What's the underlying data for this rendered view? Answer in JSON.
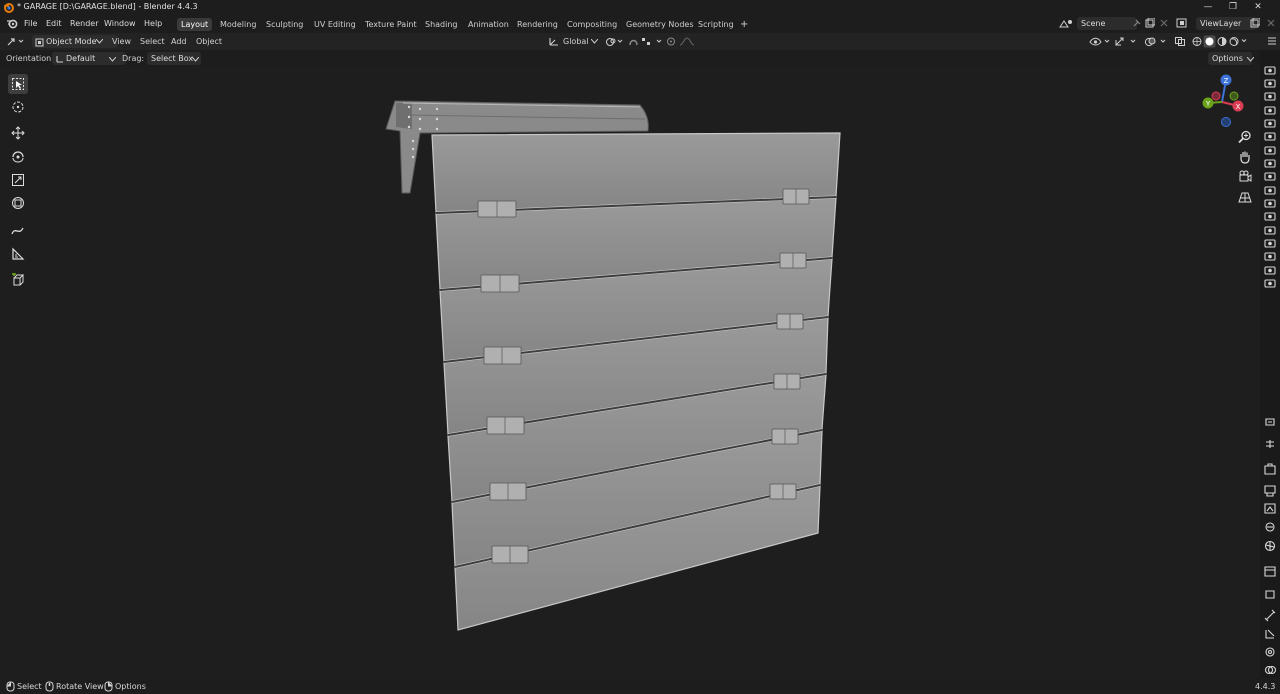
{
  "window": {
    "title": "* GARAGE [D:\\GARAGE.blend] - Blender 4.4.3",
    "minimize": "—",
    "restore": "❐",
    "close": "✕"
  },
  "menu": [
    "File",
    "Edit",
    "Render",
    "Window",
    "Help"
  ],
  "workspaces": [
    "Layout",
    "Modeling",
    "Sculpting",
    "UV Editing",
    "Texture Paint",
    "Shading",
    "Animation",
    "Rendering",
    "Compositing",
    "Geometry Nodes",
    "Scripting"
  ],
  "workspace_add": "+",
  "scene": {
    "name": "Scene",
    "viewlayer": "ViewLayer"
  },
  "header": {
    "mode": "Object Mode",
    "view": "View",
    "select": "Select",
    "add": "Add",
    "object": "Object",
    "transform_orientation": "Global"
  },
  "toolsettings": {
    "orientation_label": "Orientation:",
    "orientation_value": "Default",
    "drag_label": "Drag:",
    "drag_value": "Select Box",
    "options": "Options"
  },
  "gizmo": {
    "x": "X",
    "y": "Y",
    "z": "Z"
  },
  "status": {
    "select": "Select",
    "rotate": "Rotate View",
    "options": "Options",
    "version": "4.4.3"
  },
  "colors": {
    "accent": "#3a3a3a",
    "axis_x": "#d93d54",
    "axis_y": "#6ba31a",
    "axis_z": "#3d72d9",
    "panel": "#8f8f8f"
  }
}
